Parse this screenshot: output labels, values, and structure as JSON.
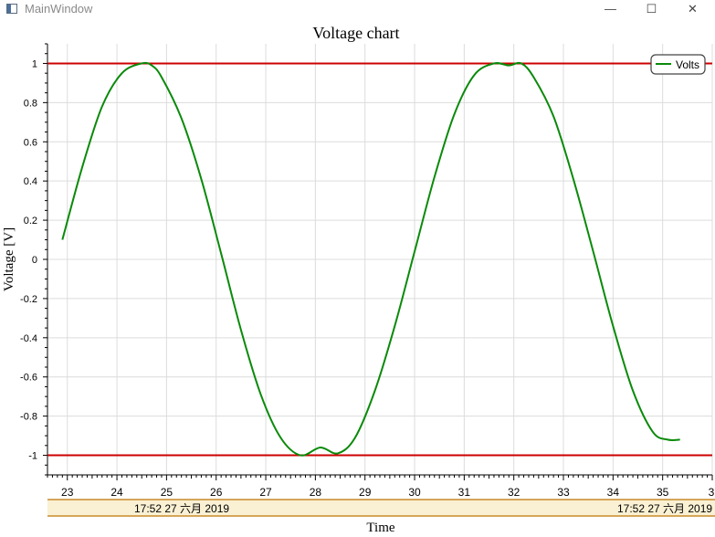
{
  "window": {
    "title": "MainWindow",
    "controls": {
      "minimize": "—",
      "maximize": "☐",
      "close": "✕"
    }
  },
  "chart_data": {
    "type": "line",
    "title": "Voltage chart",
    "xlabel": "Time",
    "ylabel": "Voltage [V]",
    "xlim": [
      22.6,
      36.0
    ],
    "ylim": [
      -1.1,
      1.1
    ],
    "x_ticks": [
      "23",
      "24",
      "25",
      "26",
      "27",
      "28",
      "29",
      "30",
      "31",
      "32",
      "33",
      "34",
      "35",
      "3"
    ],
    "y_ticks": [
      "1",
      "0.8",
      "0.6",
      "0.4",
      "0.2",
      "0",
      "-0.2",
      "-0.4",
      "-0.6",
      "-0.8",
      "-1"
    ],
    "date_labels": [
      "17:52 27 六月 2019",
      "17:52 27 六月 2019"
    ],
    "grid": true,
    "legend": "top-right",
    "series": [
      {
        "name": "Volts",
        "color": "#0a8a0a",
        "x": [
          22.9,
          23.3,
          23.7,
          24.1,
          24.5,
          24.7,
          24.9,
          25.3,
          25.7,
          26.1,
          26.5,
          26.9,
          27.3,
          27.7,
          28.1,
          28.45,
          28.8,
          29.2,
          29.6,
          30.0,
          30.4,
          30.8,
          31.2,
          31.6,
          31.9,
          32.15,
          32.4,
          32.8,
          33.2,
          33.6,
          34.0,
          34.4,
          34.8,
          35.1,
          35.35
        ],
        "y": [
          0.1,
          0.47,
          0.78,
          0.95,
          1.0,
          0.99,
          0.93,
          0.72,
          0.41,
          0.03,
          -0.36,
          -0.69,
          -0.91,
          -1.0,
          -0.96,
          -0.99,
          -0.91,
          -0.67,
          -0.34,
          0.04,
          0.42,
          0.74,
          0.94,
          1.0,
          0.99,
          1.0,
          0.93,
          0.73,
          0.41,
          0.04,
          -0.34,
          -0.67,
          -0.88,
          -0.92,
          -0.92
        ]
      }
    ],
    "limit_lines": [
      {
        "y": 1,
        "color": "#cc0000"
      },
      {
        "y": -1,
        "color": "#cc0000"
      }
    ]
  }
}
